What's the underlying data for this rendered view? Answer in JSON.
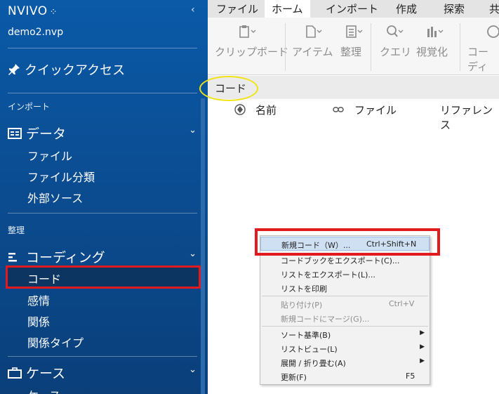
{
  "app": {
    "logo": "NVIVO",
    "logo_mark": "⁘",
    "project": "demo2.nvp"
  },
  "sidebar": {
    "quick_access": "クイックアクセス",
    "import_label": "インポート",
    "data_group": "データ",
    "data_items": [
      "ファイル",
      "ファイル分類",
      "外部ソース"
    ],
    "organize_label": "整理",
    "coding_group": "コーディング",
    "coding_items": [
      "コード",
      "感情",
      "関係",
      "関係タイプ"
    ],
    "cases_group": "ケース",
    "cases_items": [
      "ケース"
    ]
  },
  "ribbon": {
    "tabs": [
      "ファイル",
      "ホーム",
      "インポート",
      "作成",
      "探索",
      "共"
    ],
    "active_tab": "ホーム",
    "groups": [
      "クリップボード",
      "アイテム",
      "整理",
      "クエリ",
      "視覚化",
      "コーディ"
    ]
  },
  "code_view": {
    "title": "コード",
    "columns": [
      "名前",
      "ファイル",
      "リファレンス"
    ]
  },
  "context_menu": {
    "items": [
      {
        "label": "新規コード（W）...",
        "shortcut": "Ctrl+Shift+N"
      },
      {
        "label": "コードブックをエクスポート(C)..."
      },
      {
        "label": "リストをエクスポート(L)..."
      },
      {
        "label": "リストを印刷"
      },
      {
        "label": "貼り付け(P)",
        "shortcut": "Ctrl+V"
      },
      {
        "label": "新規コードにマージ(G)..."
      },
      {
        "label": "ソート基準(B)"
      },
      {
        "label": "リストビュー(L)"
      },
      {
        "label": "展開 / 折り畳む(A)"
      },
      {
        "label": "更新(F)",
        "shortcut": "F5"
      }
    ]
  },
  "colors": {
    "sidebar": "#0b4d92",
    "highlight_red": "#e11a1f",
    "highlight_yellow": "#f2e313"
  }
}
